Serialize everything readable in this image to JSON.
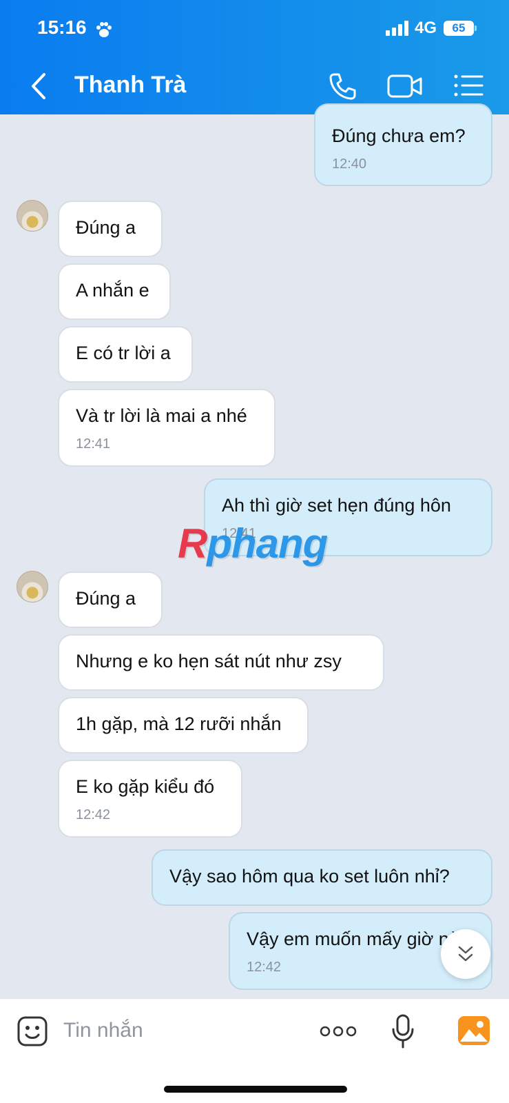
{
  "status_bar": {
    "time": "15:16",
    "network": "4G",
    "battery": "65"
  },
  "header": {
    "contact_name": "Thanh Trà"
  },
  "messages": [
    {
      "text": "Đúng chưa em?",
      "time": "12:40"
    },
    {
      "text": "Đúng a"
    },
    {
      "text": "A nhắn e"
    },
    {
      "text": "E có tr lời a"
    },
    {
      "text": "Và tr lời là mai a nhé",
      "time": "12:41"
    },
    {
      "text": "Ah thì giờ set hẹn đúng hôn",
      "time": "12:41"
    },
    {
      "text": "Đúng a"
    },
    {
      "text": "Nhưng e ko hẹn sát nút như zsy"
    },
    {
      "text": "1h gặp, mà 12 rưỡi nhắn"
    },
    {
      "text": "E ko gặp kiểu đó",
      "time": "12:42"
    },
    {
      "text": "Vậy sao hôm qua ko set luôn nhỉ?"
    },
    {
      "text": "Vậy em muốn mấy giờ nè",
      "time": "12:42"
    }
  ],
  "watermark": {
    "first": "R",
    "rest": "phang"
  },
  "input": {
    "placeholder": "Tin nhắn"
  },
  "colors": {
    "header": "#0a7cf0",
    "incoming_bubble": "#ffffff",
    "outgoing_bubble": "#d3edfb",
    "chat_background": "#e3e8f0"
  }
}
